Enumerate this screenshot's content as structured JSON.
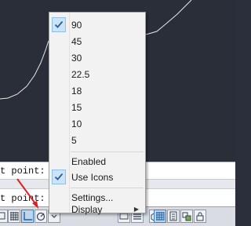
{
  "command_line": {
    "line1": "t point:",
    "line2": "t point:"
  },
  "context_menu": {
    "angles": [
      {
        "label": "90",
        "checked": true
      },
      {
        "label": "45",
        "checked": false
      },
      {
        "label": "30",
        "checked": false
      },
      {
        "label": "22.5",
        "checked": false
      },
      {
        "label": "18",
        "checked": false
      },
      {
        "label": "15",
        "checked": false
      },
      {
        "label": "10",
        "checked": false
      },
      {
        "label": "5",
        "checked": false
      }
    ],
    "enabled_label": "Enabled",
    "enabled_checked": false,
    "use_icons_label": "Use Icons",
    "use_icons_checked": true,
    "settings_label": "Settings...",
    "display_label": "Display",
    "display_arrow": "▶"
  },
  "colors": {
    "check_highlight": "#cce4f7",
    "check_mark": "#2a5d9f",
    "annotation_arrow": "#e02020"
  },
  "statusbar": {
    "icons": [
      "grid-icon",
      "ortho-icon",
      "polar-tracking-icon",
      "osnap-icon",
      "otrack-icon",
      "ucs-icon",
      "dyn-icon",
      "lineweight-icon",
      "transparency-icon",
      "selection-cycling-icon",
      "annotation-monitor-icon",
      "units-icon",
      "quick-properties-icon",
      "lock-ui-icon",
      "isolate-objects-icon",
      "hardware-acceleration-icon",
      "clean-screen-icon"
    ]
  }
}
